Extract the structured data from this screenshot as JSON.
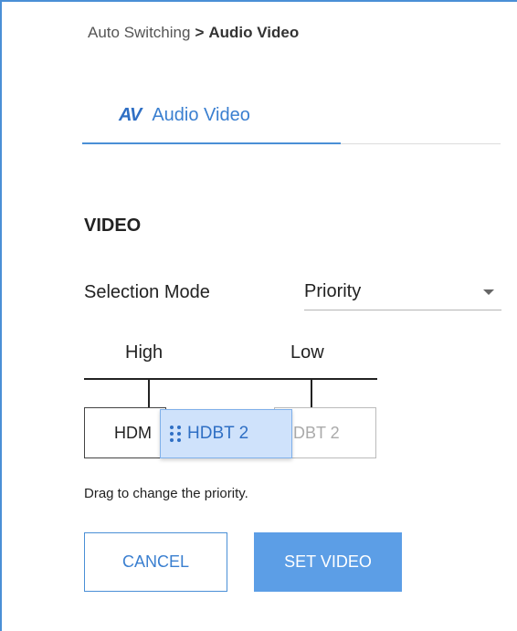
{
  "breadcrumb": {
    "parent": "Auto Switching",
    "separator": ">",
    "current": "Audio Video"
  },
  "tab": {
    "icon_text": "AV",
    "icon": "av-icon",
    "label": "Audio Video"
  },
  "section": {
    "title": "VIDEO"
  },
  "selection_mode": {
    "label": "Selection Mode",
    "value": "Priority"
  },
  "priority": {
    "high_label": "High",
    "low_label": "Low",
    "slots": [
      "HDM",
      "DBT 2"
    ],
    "dragging_item": "HDBT 2",
    "hint": "Drag to change the priority."
  },
  "buttons": {
    "cancel": "CANCEL",
    "set_video": "SET VIDEO"
  },
  "colors": {
    "accent": "#4a8fd6",
    "primary_button": "#5c9ee6",
    "drag_chip_bg": "#cfe2fb"
  }
}
